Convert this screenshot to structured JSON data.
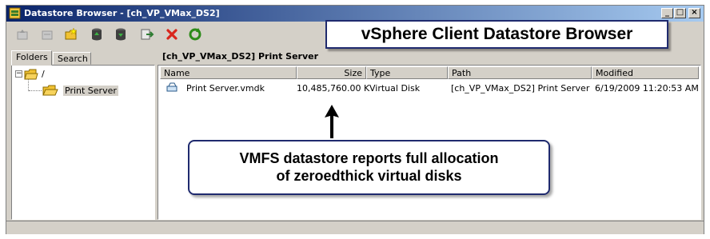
{
  "window": {
    "title": "Datastore Browser - [ch_VP_VMax_DS2]",
    "controls": [
      "_",
      "□",
      "×"
    ]
  },
  "toolbar": {
    "icons": [
      "folder-up-icon",
      "folder-browse-icon",
      "new-folder-icon",
      "upload-icon",
      "download-icon",
      "move-icon",
      "delete-icon",
      "refresh-icon"
    ]
  },
  "annotation": {
    "title": "vSphere Client Datastore Browser"
  },
  "tabs": [
    {
      "label": "Folders"
    },
    {
      "label": "Search"
    }
  ],
  "tree": {
    "root": "/",
    "child": "Print Server"
  },
  "path_label": "[ch_VP_VMax_DS2] Print Server",
  "table": {
    "columns": [
      "Name",
      "Size",
      "Type",
      "Path",
      "Modified"
    ],
    "rows": [
      {
        "name": "Print Server.vmdk",
        "size": "10,485,760.00 K",
        "type": "Virtual Disk",
        "path": "[ch_VP_VMax_DS2] Print Server",
        "modified": "6/19/2009 11:20:53 AM"
      }
    ]
  },
  "callout": {
    "line1": "VMFS datastore reports full allocation",
    "line2": "of zeroedthick virtual disks"
  },
  "colors": {
    "titlebar_start": "#0a246a",
    "titlebar_end": "#a6caf0",
    "callout_border": "#1f2a6e",
    "delete_red": "#d9261c",
    "refresh_green": "#2e8b1a"
  }
}
